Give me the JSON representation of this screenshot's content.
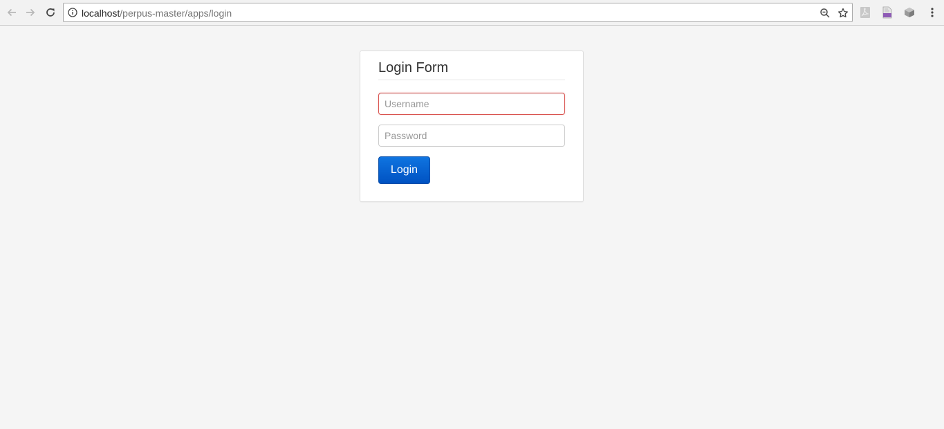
{
  "browser": {
    "url_host": "localhost",
    "url_path": "/perpus-master/apps/login"
  },
  "login": {
    "title": "Login Form",
    "username_placeholder": "Username",
    "password_placeholder": "Password",
    "button_label": "Login"
  },
  "colors": {
    "primary": "#0052c2",
    "error_border": "#d9534f",
    "page_bg": "#f5f5f5"
  },
  "icons": [
    "back-arrow-icon",
    "forward-arrow-icon",
    "reload-icon",
    "info-icon",
    "zoom-icon",
    "star-icon",
    "acrobat-icon",
    "pdf-icon",
    "extension-icon",
    "menu-dots-icon"
  ]
}
